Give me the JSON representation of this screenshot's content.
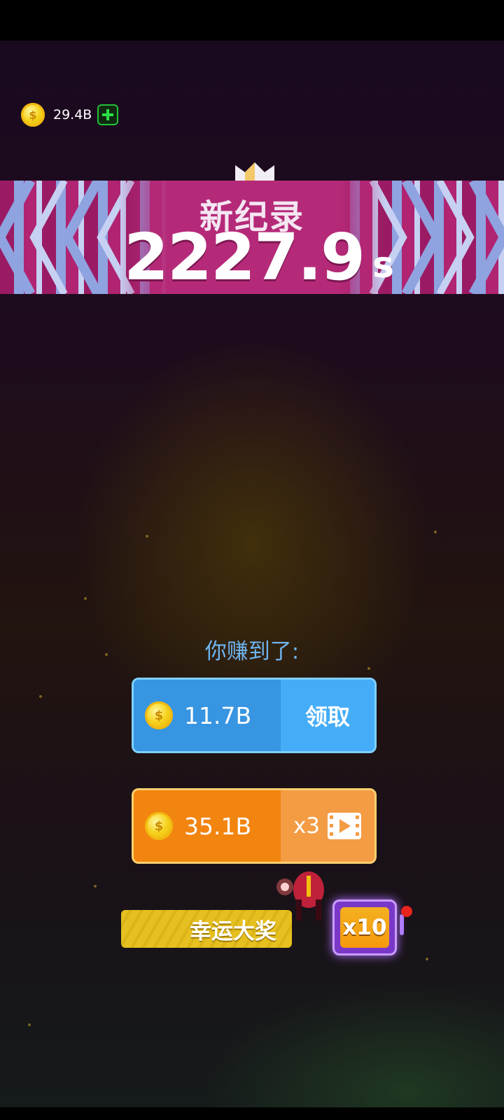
{
  "wallet": {
    "amount": "29.4B",
    "add_icon": "plus-icon",
    "coin_icon": "coin-icon"
  },
  "record": {
    "title": "新纪录",
    "time_value": "2227.9",
    "time_unit": "s",
    "crown_icon": "crown-icon"
  },
  "earnings": {
    "label": "你赚到了:",
    "claim": {
      "amount": "11.7B",
      "action": "领取"
    },
    "multiplied": {
      "amount": "35.1B",
      "multiplier": "x3",
      "video_icon": "video-icon"
    }
  },
  "lucky": {
    "label": "幸运大奖",
    "slot_multiplier": "x10"
  },
  "colors": {
    "banner_pink": "#9a1b64",
    "banner_blue": "#8fa3e0",
    "claim_blue": "#3aa2ea",
    "multi_orange": "#f58a12",
    "lucky_yellow": "#e6c020",
    "slot_purple": "#7a38c8",
    "add_green": "#2be048"
  }
}
